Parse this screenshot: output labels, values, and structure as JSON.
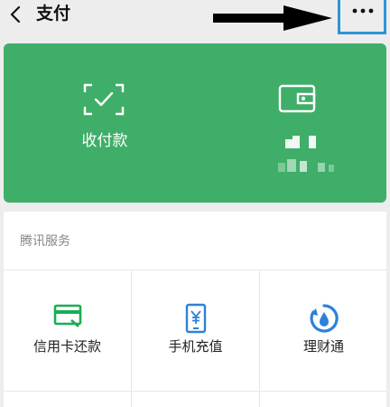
{
  "header": {
    "title": "支付",
    "back_icon": "chevron-left-icon",
    "more_icon": "more-dots-icon"
  },
  "green_card": {
    "background": "#3fae68",
    "pay": {
      "label": "收付款",
      "icon": "scan-check-icon"
    },
    "wallet": {
      "icon": "wallet-icon"
    }
  },
  "services": {
    "section_title": "腾讯服务",
    "items": [
      {
        "label": "信用卡还款",
        "icon": "credit-card-icon",
        "color": "#1aad57"
      },
      {
        "label": "手机充值",
        "icon": "phone-yuan-icon",
        "color": "#2f80d8"
      },
      {
        "label": "理财通",
        "icon": "wealth-drop-icon",
        "color": "#2f80d8"
      }
    ]
  },
  "annotation": {
    "arrow_color": "#000000",
    "highlight_color": "#2d93d6"
  }
}
